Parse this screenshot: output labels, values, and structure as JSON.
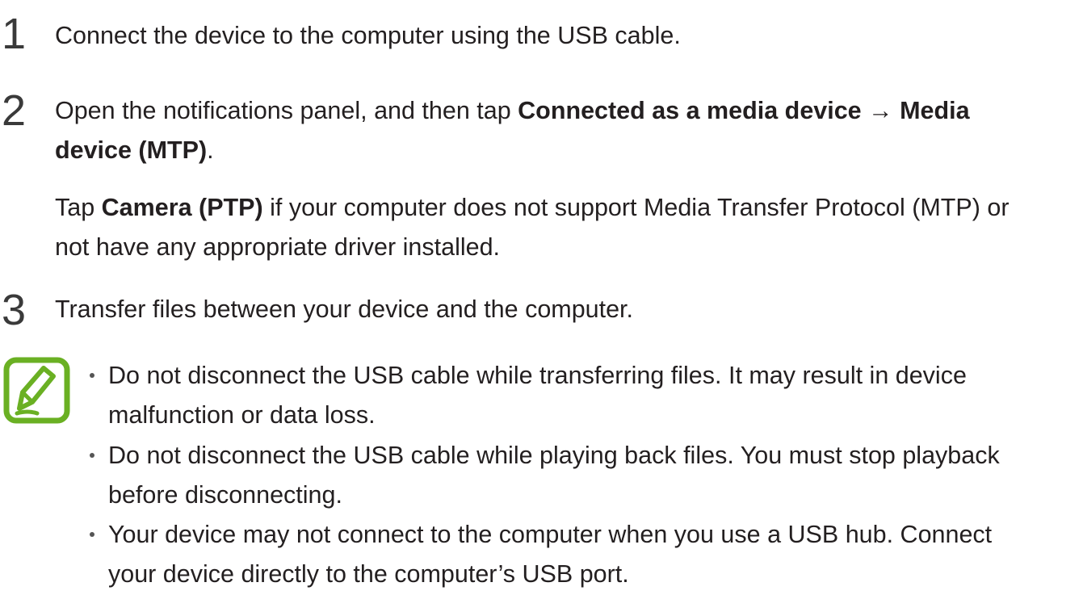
{
  "steps": [
    {
      "number": "1",
      "text": "Connect the device to the computer using the USB cable."
    },
    {
      "number": "2",
      "line1_prefix": "Open the notifications panel, and then tap ",
      "line1_bold1": "Connected as a media device",
      "line1_arrow": " → ",
      "line1_bold2": "Media",
      "line2_bold": "device (MTP)",
      "line2_suffix": ".",
      "sub_prefix": "Tap ",
      "sub_bold": "Camera (PTP)",
      "sub_line1_suffix": " if your computer does not support Media Transfer Protocol (MTP) or",
      "sub_line2": "not have any appropriate driver installed."
    },
    {
      "number": "3",
      "text": "Transfer files between your device and the computer."
    }
  ],
  "note": {
    "icon": "note-pencil-icon",
    "icon_color": "#6ab023",
    "bullets": [
      {
        "line1": "Do not disconnect the USB cable while transferring files. It may result in device",
        "line2": "malfunction or data loss."
      },
      {
        "line1": "Do not disconnect the USB cable while playing back files. You must stop playback",
        "line2": "before disconnecting."
      },
      {
        "line1": "Your device may not connect to the computer when you use a USB hub. Connect",
        "line2": "your device directly to the computer’s USB port."
      }
    ]
  }
}
